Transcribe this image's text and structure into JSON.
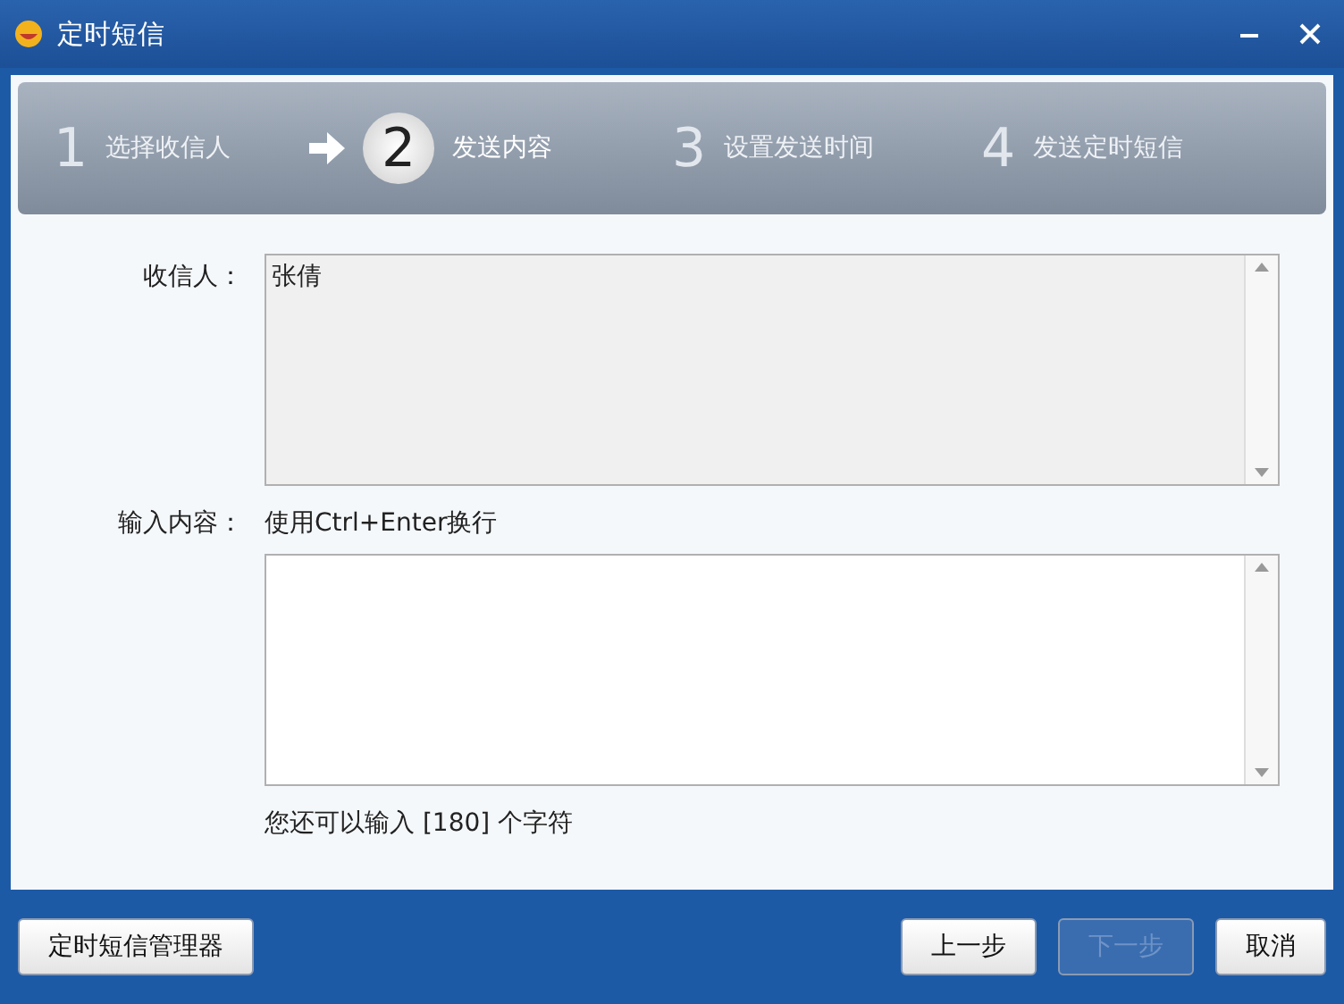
{
  "window": {
    "title": "定时短信"
  },
  "steps": [
    {
      "number": "1",
      "label": "选择收信人",
      "selected": false
    },
    {
      "number": "2",
      "label": "发送内容",
      "selected": true
    },
    {
      "number": "3",
      "label": "设置发送时间",
      "selected": false
    },
    {
      "number": "4",
      "label": "发送定时短信",
      "selected": false
    }
  ],
  "recipients": {
    "label": "收信人：",
    "value": "张倩"
  },
  "message": {
    "label": "输入内容：",
    "hint": "使用Ctrl+Enter换行",
    "remaining": "您还可以输入 [180] 个字符"
  },
  "buttons": [
    {
      "label": "定时短信管理器",
      "disabled": false
    },
    {
      "label": "上一步",
      "disabled": false
    },
    {
      "label": "下一步",
      "disabled": true
    },
    {
      "label": "取消",
      "disabled": false
    }
  ]
}
